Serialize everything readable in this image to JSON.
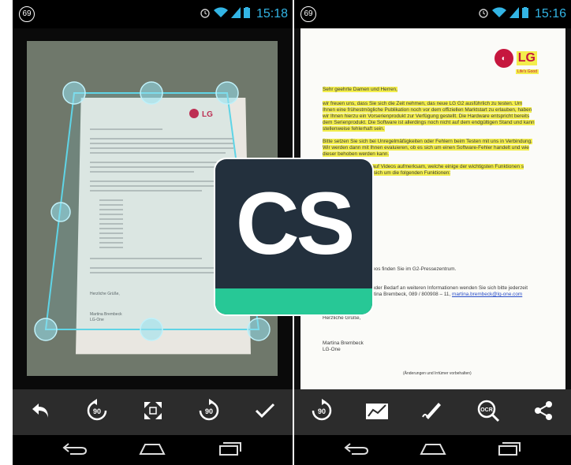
{
  "colors": {
    "accent": "#33b5e5",
    "cs_dark": "#23303d",
    "cs_green": "#27c896",
    "highlight": "#f3ee4c",
    "lg_red": "#c6173e"
  },
  "left_phone": {
    "status": {
      "badge": "69",
      "time": "15:18"
    },
    "toolbar": {
      "buttons": [
        {
          "icon": "undo-icon"
        },
        {
          "icon": "rotate-left-90-icon",
          "label": "90"
        },
        {
          "icon": "expand-full-icon"
        },
        {
          "icon": "rotate-right-90-icon",
          "label": "90"
        },
        {
          "icon": "checkmark-icon"
        }
      ]
    },
    "document": {
      "logo_text": "LG",
      "closing": "Herzliche Grüße,",
      "signature_name": "Martina Brembeck",
      "signature_org": "LG-One"
    }
  },
  "right_phone": {
    "status": {
      "badge": "69",
      "time": "15:16"
    },
    "toolbar": {
      "buttons": [
        {
          "icon": "rotate-90-icon",
          "label": "90"
        },
        {
          "icon": "enhance-chart-icon"
        },
        {
          "icon": "pen-icon"
        },
        {
          "icon": "ocr-search-icon",
          "label": "OCR"
        },
        {
          "icon": "share-icon"
        }
      ]
    },
    "document": {
      "logo_text": "LG",
      "logo_tagline": "Life's Good",
      "salutation": "Sehr geehrte Damen und Herren,",
      "para1": "wir freuen uns, dass Sie sich die Zeit nehmen, das neue LG G2 ausführlich zu testen. Um Ihnen eine frühestmögliche Publikation noch vor dem offiziellen Marktstart zu erlauben, haben wir Ihnen hierzu ein Vorserienprodukt zur Verfügung gestellt. Die Hardware entspricht bereits dem Serienprodukt. Die Software ist allerdings noch nicht auf dem endgültigen Stand und kann stellenweise fehlerhaft sein.",
      "para2": "Bitte setzen Sie sich bei Unregelmäßigkeiten oder Fehlern beim Testen mit uns in Verbindung. Wir werden dann mit Ihnen evaluieren, ob es sich um einen Software-Fehler handelt und wie dieser behoben werden kann.",
      "para3": "e auch auf Videos aufmerksam, welche einige der wichtigsten Funktionen s handelt sich um die folgenden Funktionen:",
      "videos_line": "Videos finden Sie im G2-Pressezentrum.",
      "contact_line": "en oder Bedarf an weiteren Informationen wenden Sie sich bitte jederzeit",
      "contact_line2": "Martina Brembeck, 089 / 800908 – 11,",
      "contact_email": "martina.brembeck@lg-one.com",
      "closing": "Herzliche Grüße,",
      "signature_name": "Martina Brembeck",
      "signature_org": "LG-One",
      "footer": "(Änderungen und Irrtümer vorbehalten)"
    }
  },
  "center_logo": {
    "text": "CS"
  }
}
